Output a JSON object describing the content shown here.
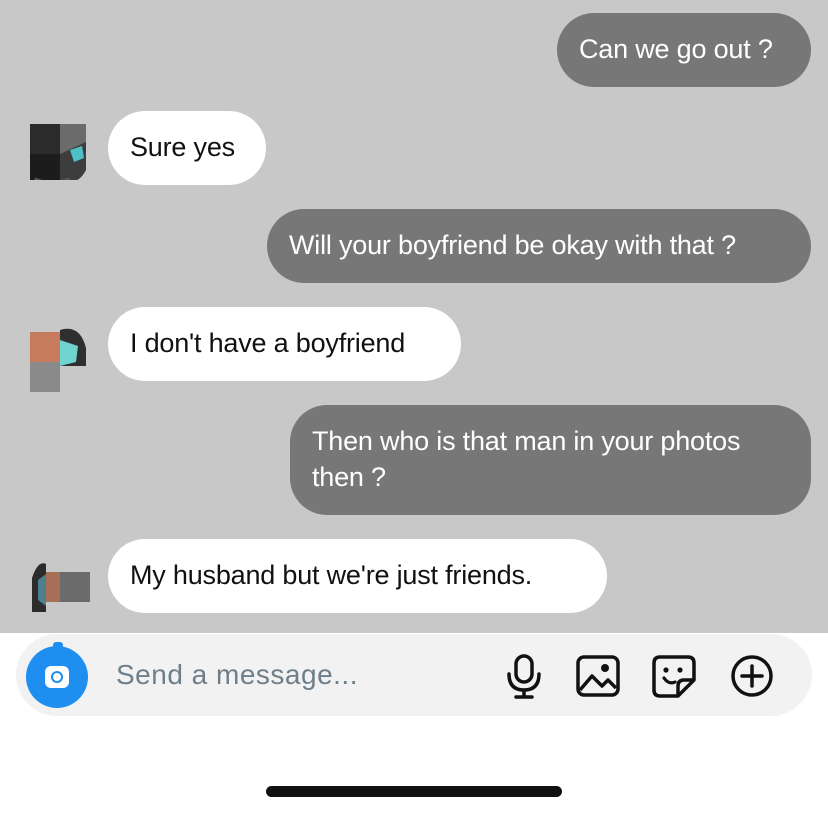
{
  "conversation": {
    "messages": [
      {
        "direction": "outgoing",
        "text": "Can we go out ?"
      },
      {
        "direction": "incoming",
        "text": "Sure yes"
      },
      {
        "direction": "outgoing",
        "text": "Will your boyfriend be okay with that ?"
      },
      {
        "direction": "incoming",
        "text": "I don't have a boyfriend"
      },
      {
        "direction": "outgoing",
        "text": "Then who is that man in your photos then ?"
      },
      {
        "direction": "incoming",
        "text": "My husband but we're just friends."
      }
    ]
  },
  "composer": {
    "placeholder": "Send a message...",
    "value": "",
    "icons": [
      "camera-icon",
      "microphone-icon",
      "image-icon",
      "sticker-icon",
      "plus-circle-icon"
    ]
  },
  "colors": {
    "chat_background": "#c8c8c8",
    "outgoing_bubble": "#777777",
    "incoming_bubble": "#ffffff",
    "accent": "#1f8ef1"
  }
}
